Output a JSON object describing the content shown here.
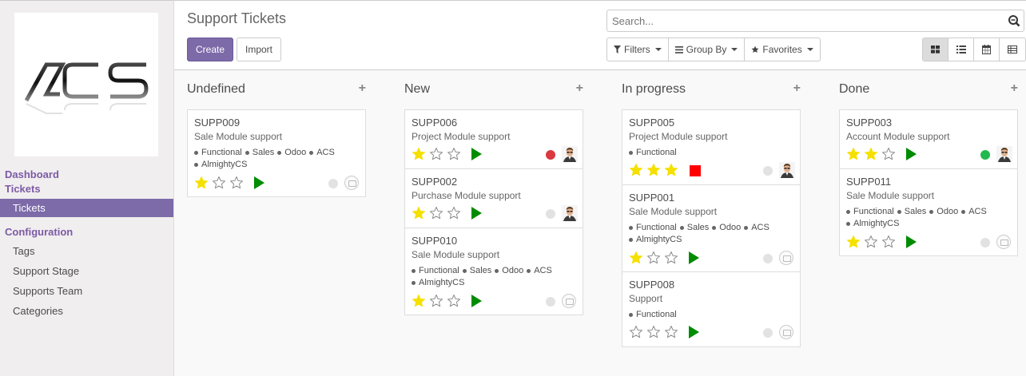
{
  "sidebar": {
    "logo_text": "ACS",
    "dashboard": "Dashboard",
    "tickets_section": "Tickets",
    "tickets_item": "Tickets",
    "configuration": "Configuration",
    "config_items": [
      "Tags",
      "Support Stage",
      "Supports Team",
      "Categories"
    ]
  },
  "header": {
    "title": "Support Tickets",
    "create_label": "Create",
    "import_label": "Import",
    "search_placeholder": "Search...",
    "filters_label": "Filters",
    "groupby_label": "Group By",
    "favorites_label": "Favorites",
    "views": [
      "kanban",
      "list",
      "calendar",
      "pivot"
    ],
    "active_view": "kanban"
  },
  "kanban": {
    "columns": [
      {
        "title": "Undefined",
        "cards": [
          {
            "ref": "SUPP009",
            "name": "Sale Module support",
            "tags": [
              "Functional",
              "Sales",
              "Odoo",
              "ACS",
              "AlmightyCS"
            ],
            "priority": 1,
            "state": "play",
            "kanban_state": "grey",
            "avatar": "camera"
          }
        ]
      },
      {
        "title": "New",
        "cards": [
          {
            "ref": "SUPP006",
            "name": "Project Module support",
            "tags": [],
            "priority": 1,
            "state": "play",
            "kanban_state": "red",
            "avatar": "person"
          },
          {
            "ref": "SUPP002",
            "name": "Purchase Module support",
            "tags": [],
            "priority": 1,
            "state": "play",
            "kanban_state": "grey",
            "avatar": "person"
          },
          {
            "ref": "SUPP010",
            "name": "Sale Module support",
            "tags": [
              "Functional",
              "Sales",
              "Odoo",
              "ACS",
              "AlmightyCS"
            ],
            "priority": 1,
            "state": "play",
            "kanban_state": "grey",
            "avatar": "camera"
          }
        ]
      },
      {
        "title": "In progress",
        "cards": [
          {
            "ref": "SUPP005",
            "name": "Project Module support",
            "tags": [
              "Functional"
            ],
            "priority": 3,
            "state": "stop",
            "kanban_state": "grey",
            "avatar": "person"
          },
          {
            "ref": "SUPP001",
            "name": "Sale Module support",
            "tags": [
              "Functional",
              "Sales",
              "Odoo",
              "ACS",
              "AlmightyCS"
            ],
            "priority": 1,
            "state": "play",
            "kanban_state": "grey",
            "avatar": "camera"
          },
          {
            "ref": "SUPP008",
            "name": "Support",
            "tags": [
              "Functional"
            ],
            "priority": 0,
            "state": "play",
            "kanban_state": "grey",
            "avatar": "camera"
          }
        ]
      },
      {
        "title": "Done",
        "cards": [
          {
            "ref": "SUPP003",
            "name": "Account Module support",
            "tags": [],
            "priority": 2,
            "state": "play",
            "kanban_state": "green",
            "avatar": "person"
          },
          {
            "ref": "SUPP011",
            "name": "Sale Module support",
            "tags": [
              "Functional",
              "Sales",
              "Odoo",
              "ACS",
              "AlmightyCS"
            ],
            "priority": 1,
            "state": "play",
            "kanban_state": "grey",
            "avatar": "camera"
          }
        ]
      }
    ]
  },
  "colors": {
    "brand": "#7c6aa9",
    "star": "#f5e000",
    "play": "#008c00",
    "stop": "#ff0000",
    "state_red": "#d9393f",
    "state_green": "#21b94e",
    "state_grey": "#e2e2e2"
  }
}
